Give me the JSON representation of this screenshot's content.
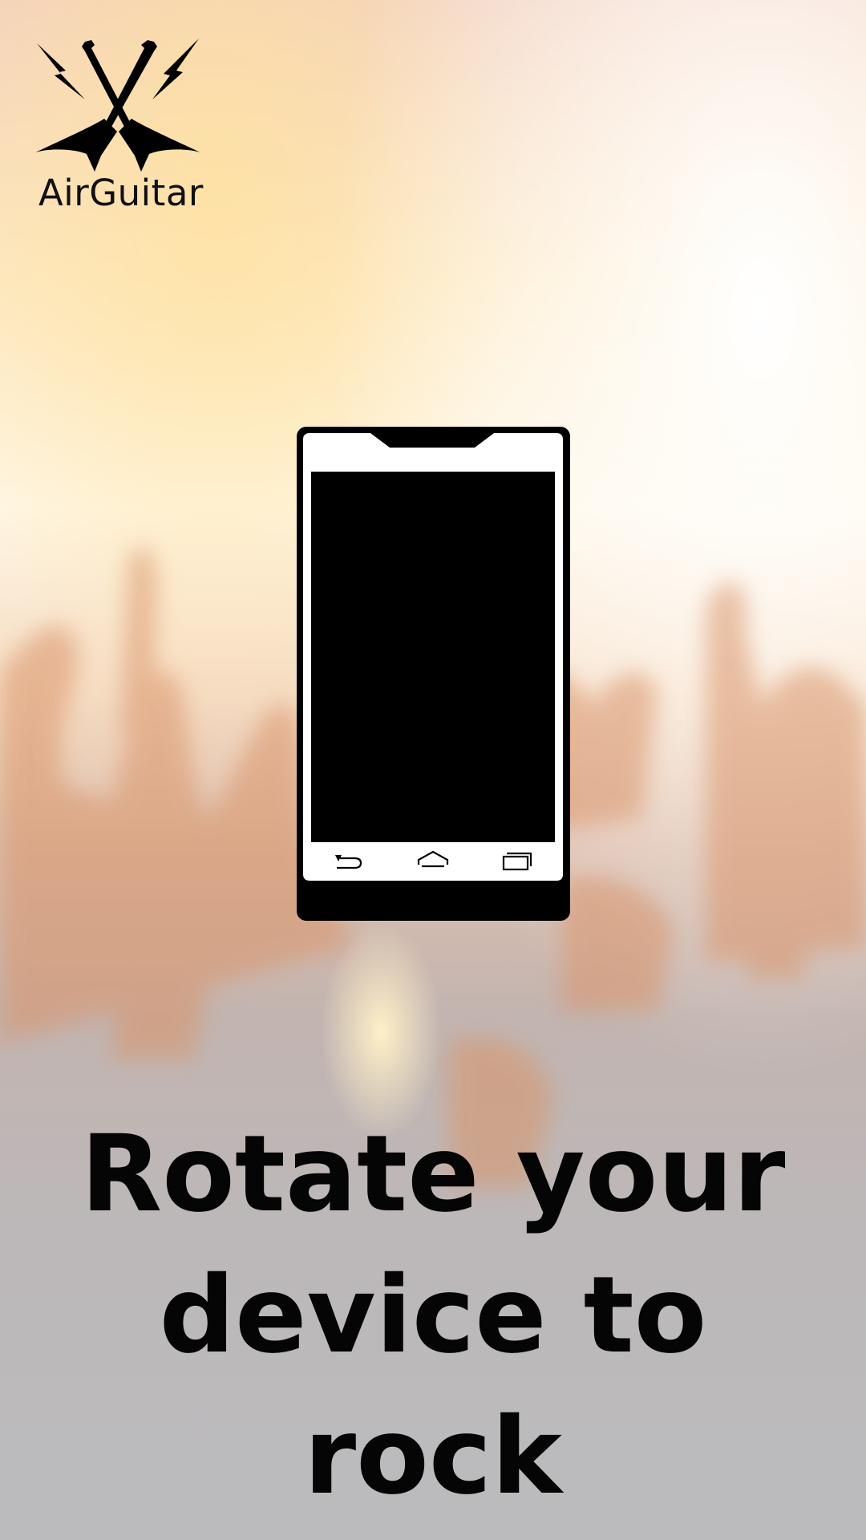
{
  "app": {
    "name": "AirGuitar"
  },
  "logo": {
    "icon": "crossed-guitars-lightning-icon"
  },
  "illustration": {
    "icon": "smartphone-portrait-icon",
    "nav_icons": [
      "back-icon",
      "home-icon",
      "recent-apps-icon"
    ]
  },
  "message": {
    "line1": "Rotate your",
    "line2": "device to rock"
  },
  "colors": {
    "text": "#050505",
    "background_lower": "#bbbbbd",
    "background_glow": "#fff4d6",
    "crowd_tint": "#d9946a"
  }
}
